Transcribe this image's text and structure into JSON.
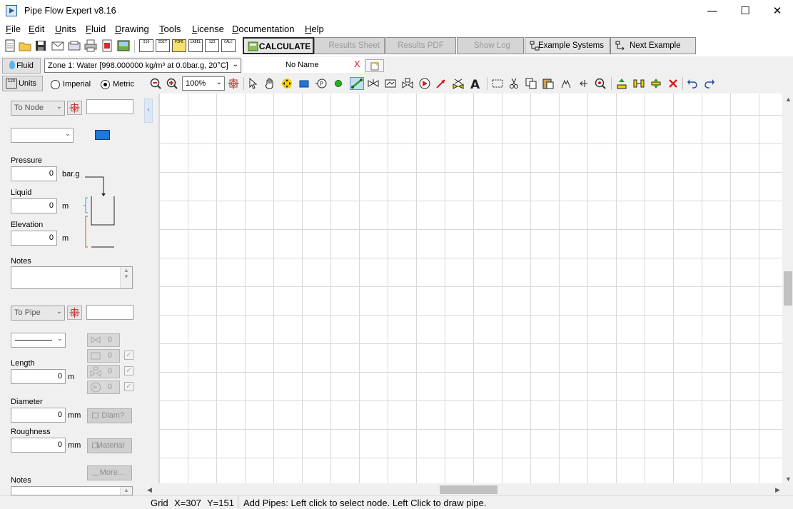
{
  "window": {
    "title": "Pipe Flow Expert v8.16",
    "minimize": "—",
    "maximize": "☐",
    "close": "✕"
  },
  "menu": [
    {
      "label": "File",
      "mnemonic": "F",
      "rest": "ile"
    },
    {
      "label": "Edit",
      "mnemonic": "E",
      "rest": "dit"
    },
    {
      "label": "Units",
      "mnemonic": "U",
      "rest": "nits"
    },
    {
      "label": "Fluid",
      "mnemonic": "F",
      "rest": "luid"
    },
    {
      "label": "Drawing",
      "mnemonic": "D",
      "rest": "rawing"
    },
    {
      "label": "Tools",
      "mnemonic": "T",
      "rest": "ools"
    },
    {
      "label": "License",
      "mnemonic": "L",
      "rest": "icense"
    },
    {
      "label": "Documentation",
      "mnemonic": "D",
      "rest": "ocumentation"
    },
    {
      "label": "Help",
      "mnemonic": "H",
      "rest": "elp"
    }
  ],
  "toolbar": {
    "small_labels": [
      "ISO",
      "EDIT",
      "PIPE",
      "LABEL",
      "123",
      "CALC"
    ],
    "calculate": "CALCULATE",
    "results_sheet": "Results Sheet",
    "results_pdf": "Results PDF",
    "show_log": "Show Log",
    "example_systems": "Example Systems",
    "next_example": "Next Example"
  },
  "fluid": {
    "button": "Fluid",
    "zone": "Zone 1: Water [998.000000 kg/m³ at 0.0bar.g, 20°C]"
  },
  "tab": {
    "name": "No Name",
    "close": "X"
  },
  "units": {
    "button": "Units",
    "imperial": "Imperial",
    "metric": "Metric",
    "selected": "Metric"
  },
  "zoom": "100%",
  "node_panel": {
    "to_node": "To Node",
    "pressure_label": "Pressure",
    "pressure_value": "0",
    "pressure_unit": "bar.g",
    "liquid_label": "Liquid",
    "liquid_value": "0",
    "liquid_unit": "m",
    "elevation_label": "Elevation",
    "elevation_value": "0",
    "elevation_unit": "m",
    "notes_label": "Notes"
  },
  "pipe_panel": {
    "to_pipe": "To Pipe",
    "fitting_counts": [
      "0",
      "0",
      "0",
      "0"
    ],
    "length_label": "Length",
    "length_value": "0",
    "length_unit": "m",
    "diameter_label": "Diameter",
    "diameter_value": "0",
    "diameter_unit": "mm",
    "diam_button": "Diam?",
    "roughness_label": "Roughness",
    "roughness_value": "0",
    "roughness_unit": "mm",
    "material_button": "Material",
    "more_button": "More...",
    "notes_label": "Notes"
  },
  "status": {
    "grid": "Grid",
    "x": "X=307",
    "y": "Y=151",
    "message": "Add Pipes: Left click to select node. Left Click to draw pipe."
  },
  "colors": {
    "tank_blue": "#1e78d8",
    "accent": "#1f5ea8",
    "node_green": "#22b022",
    "delete_red": "#e02020"
  }
}
